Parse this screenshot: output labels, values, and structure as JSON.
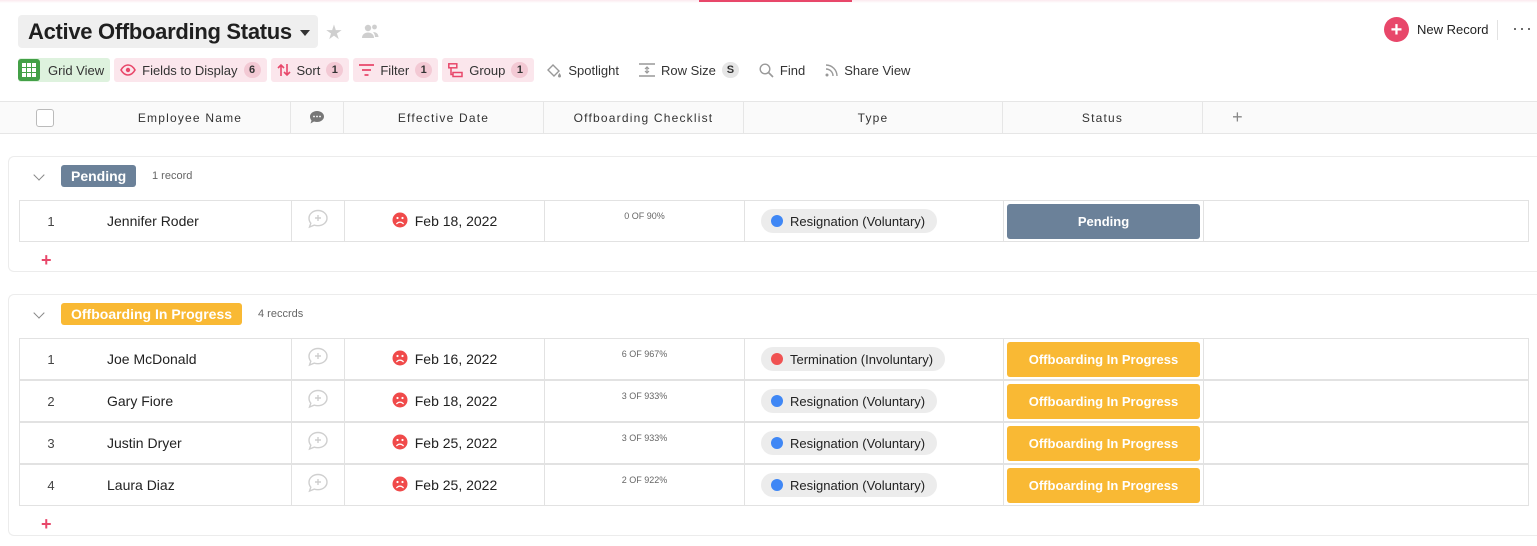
{
  "header": {
    "title": "Active Offboarding Status",
    "new_record_label": "New Record"
  },
  "toolbar": {
    "grid_view": "Grid View",
    "fields": {
      "label": "Fields to Display",
      "count": "6"
    },
    "sort": {
      "label": "Sort",
      "count": "1"
    },
    "filter": {
      "label": "Filter",
      "count": "1"
    },
    "group": {
      "label": "Group",
      "count": "1"
    },
    "spotlight": "Spotlight",
    "row_size": {
      "label": "Row Size",
      "value": "S"
    },
    "find": "Find",
    "share": "Share View"
  },
  "columns": {
    "employee_name": "Employee Name",
    "effective_date": "Effective Date",
    "checklist": "Offboarding Checklist",
    "type": "Type",
    "status": "Status"
  },
  "colors": {
    "accent": "#e8476a",
    "pending": "#6b8199",
    "in_progress": "#f9b934",
    "voluntary_dot": "#3f87f5",
    "involuntary_dot": "#f05252"
  },
  "groups": [
    {
      "label": "Pending",
      "count_text": "1 record",
      "rows": [
        {
          "num": "1",
          "name": "Jennifer Roder",
          "date": "Feb 18, 2022",
          "progress_text": "0 OF 9",
          "percent_text": "0%",
          "progress": 0,
          "type": "Resignation (Voluntary)",
          "type_dot": "voluntary",
          "status": "Pending"
        }
      ]
    },
    {
      "label": "Offboarding In Progress",
      "count_text": "4 reccrds",
      "rows": [
        {
          "num": "1",
          "name": "Joe McDonald",
          "date": "Feb 16, 2022",
          "progress_text": "6 OF 9",
          "percent_text": "67%",
          "progress": 67,
          "type": "Termination (Involuntary)",
          "type_dot": "involuntary",
          "status": "Offboarding In Progress"
        },
        {
          "num": "2",
          "name": "Gary Fiore",
          "date": "Feb 18, 2022",
          "progress_text": "3 OF 9",
          "percent_text": "33%",
          "progress": 33,
          "type": "Resignation (Voluntary)",
          "type_dot": "voluntary",
          "status": "Offboarding In Progress"
        },
        {
          "num": "3",
          "name": "Justin Dryer",
          "date": "Feb 25, 2022",
          "progress_text": "3 OF 9",
          "percent_text": "33%",
          "progress": 33,
          "type": "Resignation (Voluntary)",
          "type_dot": "voluntary",
          "status": "Offboarding In Progress"
        },
        {
          "num": "4",
          "name": "Laura Diaz",
          "date": "Feb 25, 2022",
          "progress_text": "2 OF 9",
          "percent_text": "22%",
          "progress": 22,
          "type": "Resignation (Voluntary)",
          "type_dot": "voluntary",
          "status": "Offboarding In Progress"
        }
      ]
    }
  ]
}
